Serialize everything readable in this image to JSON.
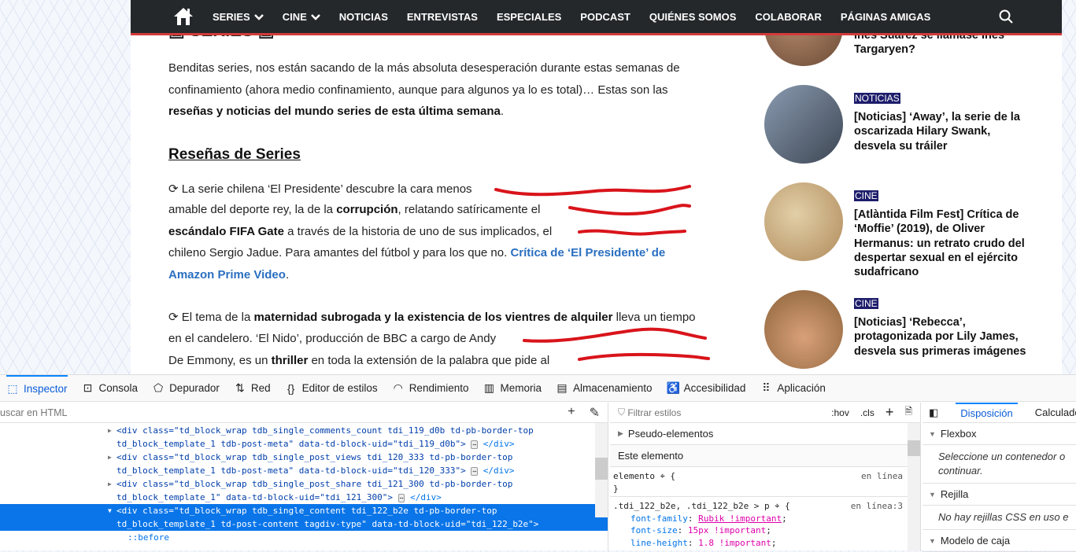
{
  "nav": {
    "items": [
      {
        "label": "SERIES",
        "dropdown": true
      },
      {
        "label": "CINE",
        "dropdown": true
      },
      {
        "label": "NOTICIAS"
      },
      {
        "label": "ENTREVISTAS"
      },
      {
        "label": "ESPECIALES"
      },
      {
        "label": "PODCAST"
      },
      {
        "label": "QUIÉNES SOMOS"
      },
      {
        "label": "COLABORAR"
      },
      {
        "label": "PÁGINAS AMIGAS"
      }
    ],
    "accent": "#d33a3a"
  },
  "article": {
    "partial_heading": "SERIES",
    "section_heading": "Reseñas de Series",
    "lines": [
      [
        {
          "t": "Benditas series, nos están sacando de la más absoluta desesperación durante estas semanas de"
        }
      ],
      [
        {
          "t": "confinamiento (ahora medio confinamiento, aunque para algunos ya lo es total)… Estas son las"
        }
      ],
      [
        {
          "t": "reseñas y noticias del mundo series de esta última semana",
          "b": true
        },
        {
          "t": "."
        }
      ],
      [
        {
          "t": "⟳ La serie chilena ‘El Presidente’ descubre la cara menos"
        }
      ],
      [
        {
          "t": "amable del deporte rey, la de la "
        },
        {
          "t": "corrupción",
          "b": true
        },
        {
          "t": ", relatando satíricamente el"
        }
      ],
      [
        {
          "t": "escándalo FIFA Gate",
          "b": true
        },
        {
          "t": " a través de la historia de uno de sus implicados, el"
        }
      ],
      [
        {
          "t": "chileno Sergio Jadue. Para amantes del fútbol y para los que no. "
        },
        {
          "t": "Crítica de ‘El Presidente’ de",
          "a": true
        }
      ],
      [
        {
          "t": "Amazon Prime Video",
          "a": true
        },
        {
          "t": "."
        }
      ],
      [
        {
          "t": "⟳ El tema de la "
        },
        {
          "t": "maternidad subrogada y la existencia de los vientres de alquiler",
          "b": true
        },
        {
          "t": " lleva un tiempo"
        }
      ],
      [
        {
          "t": "en el candelero. ‘El Nido’, producción de BBC a cargo de Andy"
        }
      ],
      [
        {
          "t": "De Emmony, es un "
        },
        {
          "t": "thriller",
          "b": true
        },
        {
          "t": " en toda la extensión de la palabra que pide al"
        }
      ]
    ]
  },
  "sidebar": {
    "items": [
      {
        "category": "",
        "title": "Inés Suárez se llamase Inés Targaryen?"
      },
      {
        "category": "NOTICIAS",
        "title": "[Noticias] ‘Away’, la serie de la oscarizada Hilary Swank, desvela su tráiler"
      },
      {
        "category": "CINE",
        "title": "[Atlàntida Film Fest] Crítica de ‘Moffie’ (2019), de Oliver Hermanus: un retrato crudo del despertar sexual en el ejército sudafricano"
      },
      {
        "category": "CINE",
        "title": "[Noticias] ‘Rebecca’, protagonizada por Lily James, desvela sus primeras imágenes"
      }
    ]
  },
  "devtools": {
    "tabs": [
      {
        "label": "Inspector",
        "icon": "inspector-icon",
        "active": true
      },
      {
        "label": "Consola",
        "icon": "console-icon"
      },
      {
        "label": "Depurador",
        "icon": "debugger-icon"
      },
      {
        "label": "Red",
        "icon": "network-icon"
      },
      {
        "label": "Editor de estilos",
        "icon": "braces-icon"
      },
      {
        "label": "Rendimiento",
        "icon": "performance-icon"
      },
      {
        "label": "Memoria",
        "icon": "memory-icon"
      },
      {
        "label": "Almacenamiento",
        "icon": "storage-icon"
      },
      {
        "label": "Accesibilidad",
        "icon": "accessibility-icon"
      },
      {
        "label": "Aplicación",
        "icon": "application-icon"
      }
    ],
    "html_search_placeholder": "uscar en HTML",
    "nodes": [
      {
        "l1": "<div class=\"td_block_wrap tdb_single_comments_count tdi_119_d0b td-pb-border-top",
        "l2": "td_block_template_1 tdb-post-meta\" data-td-block-uid=\"tdi_119_d0b\">",
        "end": "</div>"
      },
      {
        "l1": "<div class=\"td_block_wrap tdb_single_post_views tdi_120_333 td-pb-border-top",
        "l2": "td_block_template_1 tdb-post-meta\" data-td-block-uid=\"tdi_120_333\">",
        "end": "</div>"
      },
      {
        "l1": "<div class=\"td_block_wrap tdb_single_post_share tdi_121_300 td-pb-border-top",
        "l2": "td_block_template_1\" data-td-block-uid=\"tdi_121_300\">",
        "end": "</div>"
      },
      {
        "l1": "<div class=\"td_block_wrap tdb_single_content tdi_122_b2e td-pb-border-top",
        "l2": "td_block_template_1 td-post-content tagdiv-type\" data-td-block-uid=\"tdi_122_b2e\">",
        "selected": true,
        "open": true
      }
    ],
    "pseudo_before": "::before",
    "styles": {
      "filter_placeholder": "Filtrar estilos",
      "hov": ":hov",
      "cls": ".cls",
      "pseudo": "Pseudo-elementos",
      "this_element": "Este elemento",
      "element_rule": "elemento",
      "element_src": "en línea",
      "rule_selector": ".tdi_122_b2e, .tdi_122_b2e > p",
      "rule_src": "en línea:3",
      "props": [
        {
          "n": "font-family",
          "v": "Rubik !important",
          "link": true
        },
        {
          "n": "font-size",
          "v": "15px !important"
        },
        {
          "n": "line-height",
          "v": "1.8 !important"
        }
      ]
    },
    "layout": {
      "tabs": [
        "Disposición",
        "Calculado"
      ],
      "flexbox": "Flexbox",
      "flexbox_msg1": "Seleccione un contenedor o",
      "flexbox_msg2": "continuar.",
      "grid": "Rejilla",
      "grid_msg": "No hay rejillas CSS en uso e",
      "box": "Modelo de caja"
    }
  }
}
